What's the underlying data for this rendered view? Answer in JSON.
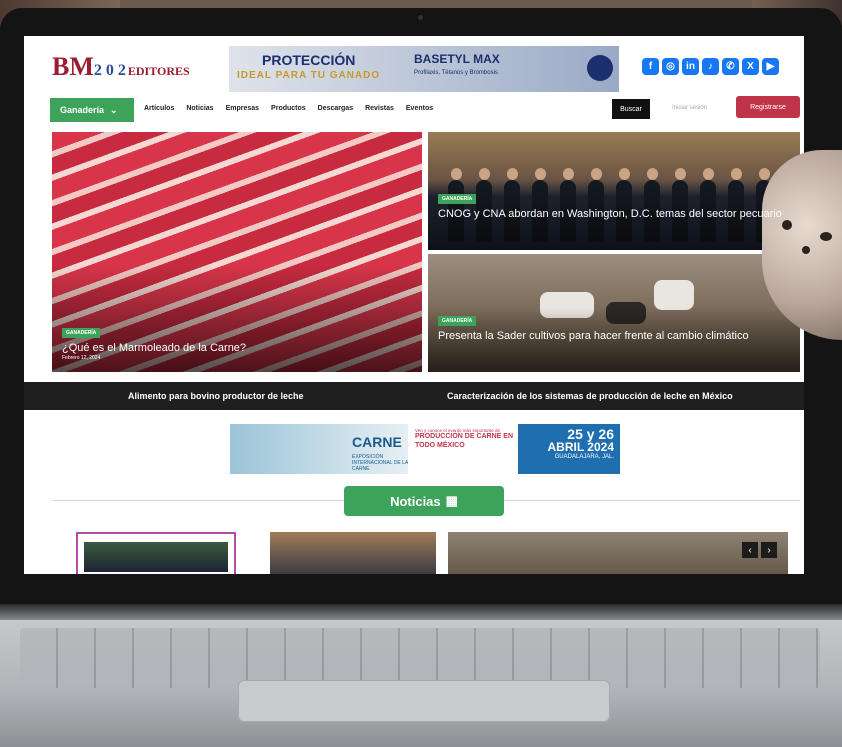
{
  "site": {
    "logo_text": "BM",
    "logo_suffix": "EDITORES",
    "logo_numbers": "2 0 2"
  },
  "banner": {
    "headline": "PROTECCIÓN",
    "subline": "IDEAL PARA TU GANADO",
    "product": "BASETYL MAX",
    "product_desc": "Profilaxis, Tétanos y Brombosis"
  },
  "socials": [
    "facebook-icon",
    "instagram-icon",
    "linkedin-icon",
    "tiktok-icon",
    "whatsapp-icon",
    "x-icon",
    "youtube-icon"
  ],
  "nav": {
    "category": "Ganadería",
    "items": [
      "Artículos",
      "Noticias",
      "Empresas",
      "Productos",
      "Descargas",
      "Revistas",
      "Eventos"
    ],
    "search_button": "Buscar",
    "login_placeholder": "Iniciar sesión",
    "register_button": "Registrarse"
  },
  "featured": {
    "main": {
      "tag": "GANADERÍA",
      "title": "¿Qué es el Marmoleado de la Carne?",
      "date": "Febrero 12, 2024"
    },
    "top_right": {
      "tag": "GANADERÍA",
      "title": "CNOG y CNA abordan en Washington, D.C. temas del sector pecuario"
    },
    "bottom_right": {
      "tag": "GANADERÍA",
      "title": "Presenta la Sader cultivos para hacer frente al cambio climático"
    }
  },
  "ticker": {
    "left": "Alimento para bovino productor de leche",
    "right": "Caracterización de los sistemas de producción de leche en México"
  },
  "event_ad": {
    "left_title": "CARNE",
    "left_sub": "EXPOSICIÓN INTERNACIONAL DE LA CARNE",
    "mid_small": "Ven y conoce el evento más importante de",
    "mid_big": "PRODUCCIÓN DE CARNE EN TODO MÉXICO",
    "dates": "25 y 26",
    "month": "ABRIL 2024",
    "city": "GUADALAJARA, JAL."
  },
  "section": {
    "title": "Noticias",
    "icon": "newspaper-icon"
  },
  "colors": {
    "brand_green": "#3ea35a",
    "brand_red": "#c0344a",
    "logo_red": "#9b1b30"
  }
}
